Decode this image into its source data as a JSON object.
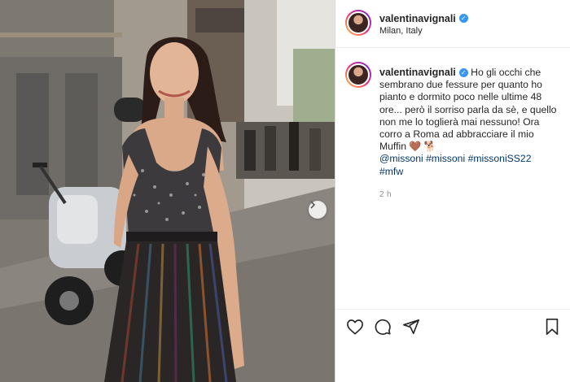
{
  "post": {
    "username": "valentinavignali",
    "location": "Milan, Italy",
    "caption": {
      "text": "Ho gli occhi che sembrano due fessure per quanto ho pianto e dormito poco nelle ultime 48 ore... però il sorriso parla da sè, e quello non me lo toglierà mai nessuno! Ora corro a Roma ad abbracciare il mio Muffin 🤎 🐕",
      "mention": "@missoni",
      "hashtags": [
        "#missoni",
        "#missoniSS22",
        "#mfw"
      ]
    },
    "time": "2 h"
  },
  "icons": {
    "verified": "verified-badge-icon",
    "like": "heart-icon",
    "comment": "comment-icon",
    "share": "send-icon",
    "save": "bookmark-icon",
    "next": "chevron-right-icon"
  },
  "colors": {
    "accent": "#3897f0",
    "link": "#00376b",
    "timestamp": "#8e8e8e",
    "avatar_ring": [
      "#f9ce34",
      "#ee2a7b",
      "#6228d7"
    ]
  }
}
